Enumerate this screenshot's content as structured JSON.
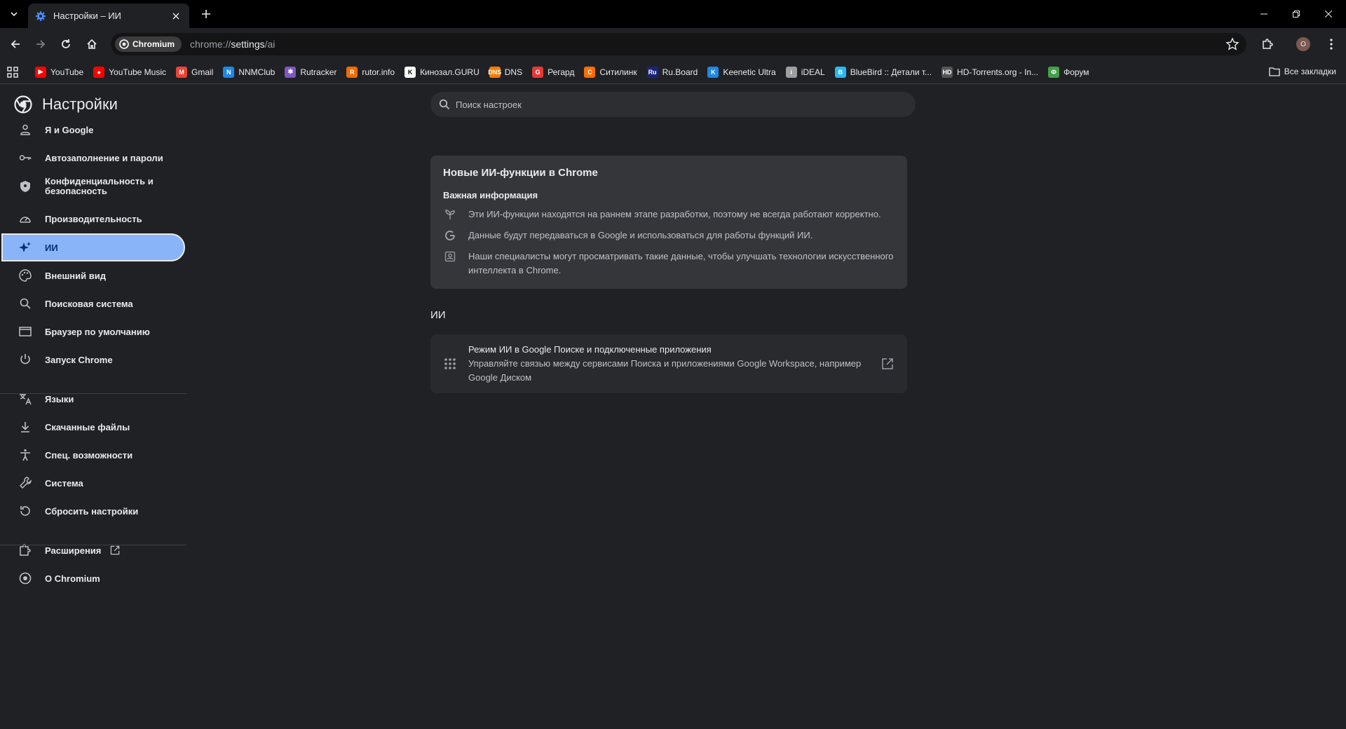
{
  "tabs": [
    {
      "title": "Настройки – ИИ"
    }
  ],
  "toolbar": {
    "chip_label": "Chromium",
    "url_scheme": "chrome://",
    "url_path": "settings",
    "url_rest": "/ai",
    "profile_initial": "O"
  },
  "bookmarks": [
    {
      "label": "YouTube",
      "color": "#ff0000",
      "glyph": "▶"
    },
    {
      "label": "YouTube Music",
      "color": "#ff0000",
      "glyph": "●"
    },
    {
      "label": "Gmail",
      "color": "#ea4335",
      "glyph": "M"
    },
    {
      "label": "NNMClub",
      "color": "#1e88e5",
      "glyph": "N"
    },
    {
      "label": "Rutracker",
      "color": "#7e57c2",
      "glyph": "✱"
    },
    {
      "label": "rutor.info",
      "color": "#ef6c00",
      "glyph": "R"
    },
    {
      "label": "Кинозал.GURU",
      "color": "#ffffff",
      "glyph": "K"
    },
    {
      "label": "DNS",
      "color": "#f57c00",
      "glyph": "DNS"
    },
    {
      "label": "Регард",
      "color": "#e53935",
      "glyph": "G"
    },
    {
      "label": "Ситилинк",
      "color": "#ff6d00",
      "glyph": "C"
    },
    {
      "label": "Ru.Board",
      "color": "#1a237e",
      "glyph": "Ru"
    },
    {
      "label": "Keenetic Ultra",
      "color": "#1e88e5",
      "glyph": "K"
    },
    {
      "label": "iDEAL",
      "color": "#9e9e9e",
      "glyph": "i"
    },
    {
      "label": "BlueBird :: Детали т...",
      "color": "#29b6f6",
      "glyph": "B"
    },
    {
      "label": "HD-Torrents.org - In...",
      "color": "#555555",
      "glyph": "HD"
    },
    {
      "label": "Форум",
      "color": "#43a047",
      "glyph": "Ф"
    }
  ],
  "all_bookmarks": "Все закладки",
  "sidebar": {
    "title": "Настройки",
    "items": [
      {
        "label": "Я и Google",
        "icon": "person-icon"
      },
      {
        "label": "Автозаполнение и пароли",
        "icon": "key-icon"
      },
      {
        "label": "Конфиденциальность и безопасность",
        "icon": "shield-icon"
      },
      {
        "label": "Производительность",
        "icon": "speedometer-icon"
      },
      {
        "label": "ИИ",
        "icon": "sparkle-icon"
      },
      {
        "label": "Внешний вид",
        "icon": "palette-icon"
      },
      {
        "label": "Поисковая система",
        "icon": "search-icon"
      },
      {
        "label": "Браузер по умолчанию",
        "icon": "browser-icon"
      },
      {
        "label": "Запуск Chrome",
        "icon": "power-icon"
      },
      {
        "label": "Языки",
        "icon": "translate-icon"
      },
      {
        "label": "Скачанные файлы",
        "icon": "download-icon"
      },
      {
        "label": "Спец. возможности",
        "icon": "accessibility-icon"
      },
      {
        "label": "Система",
        "icon": "wrench-icon"
      },
      {
        "label": "Сбросить настройки",
        "icon": "reset-icon"
      },
      {
        "label": "Расширения",
        "icon": "puzzle-icon"
      },
      {
        "label": "О Chromium",
        "icon": "chromium-icon"
      }
    ]
  },
  "search": {
    "placeholder": "Поиск настроек"
  },
  "info_card": {
    "title": "Новые ИИ-функции в Chrome",
    "subtitle": "Важная информация",
    "rows": [
      "Эти ИИ-функции находятся на раннем этапе разработки, поэтому не всегда работают корректно.",
      "Данные будут передаваться в Google и использоваться для работы функций ИИ.",
      "Наши специалисты могут просматривать такие данные, чтобы улучшать технологии искусственного интеллекта в Chrome."
    ]
  },
  "ai_section": {
    "heading": "ИИ",
    "item_title": "Режим ИИ в Google Поиске и подключенные приложения",
    "item_desc": "Управляйте связью между сервисами Поиска и приложениями Google Workspace, например Google Диском"
  },
  "colors": {
    "accent": "#8ab4f8",
    "background": "#202124",
    "card": "#35363a"
  }
}
